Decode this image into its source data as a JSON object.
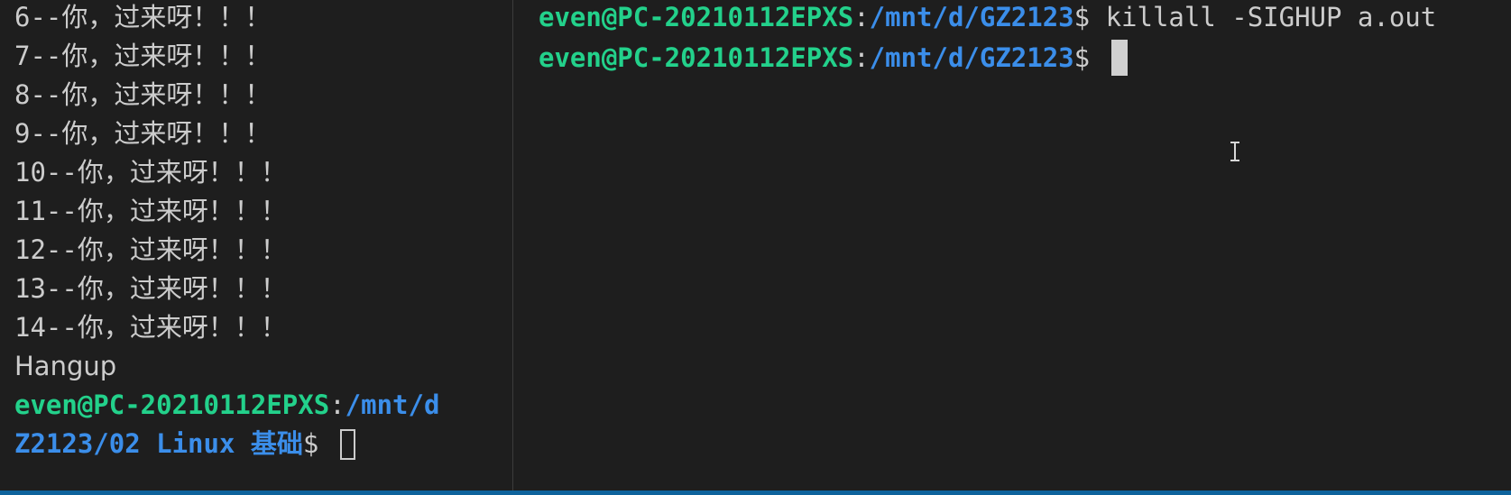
{
  "left_terminal": {
    "output_lines": [
      {
        "num": "6--",
        "text": "你，过来呀！！！"
      },
      {
        "num": "7--",
        "text": "你，过来呀！！！"
      },
      {
        "num": "8--",
        "text": "你，过来呀！！！"
      },
      {
        "num": "9--",
        "text": "你，过来呀！！！"
      },
      {
        "num": "10--",
        "text": "你，过来呀！！！"
      },
      {
        "num": "11--",
        "text": "你，过来呀！！！"
      },
      {
        "num": "12--",
        "text": "你，过来呀！！！"
      },
      {
        "num": "13--",
        "text": "你，过来呀！！！"
      },
      {
        "num": "14--",
        "text": "你，过来呀！！！"
      }
    ],
    "hangup": "Hangup",
    "prompt_user": "even@PC-20210112EPXS",
    "prompt_colon": ":",
    "prompt_path_line1": "/mnt/d",
    "prompt_path_line2": "Z2123/02 Linux ",
    "prompt_path_cjk": "基础",
    "prompt_dollar": "$ "
  },
  "right_terminal": {
    "prompt_user": "even@PC-20210112EPXS",
    "prompt_colon": ":",
    "prompt_path": "/mnt/d/GZ2123",
    "prompt_dollar": "$ ",
    "command": "killall -SIGHUP a.out"
  },
  "colors": {
    "background": "#1e1e1e",
    "user_green": "#23d18b",
    "path_blue": "#3b8eea",
    "text": "#cccccc",
    "status_strip": "#0e639c"
  }
}
